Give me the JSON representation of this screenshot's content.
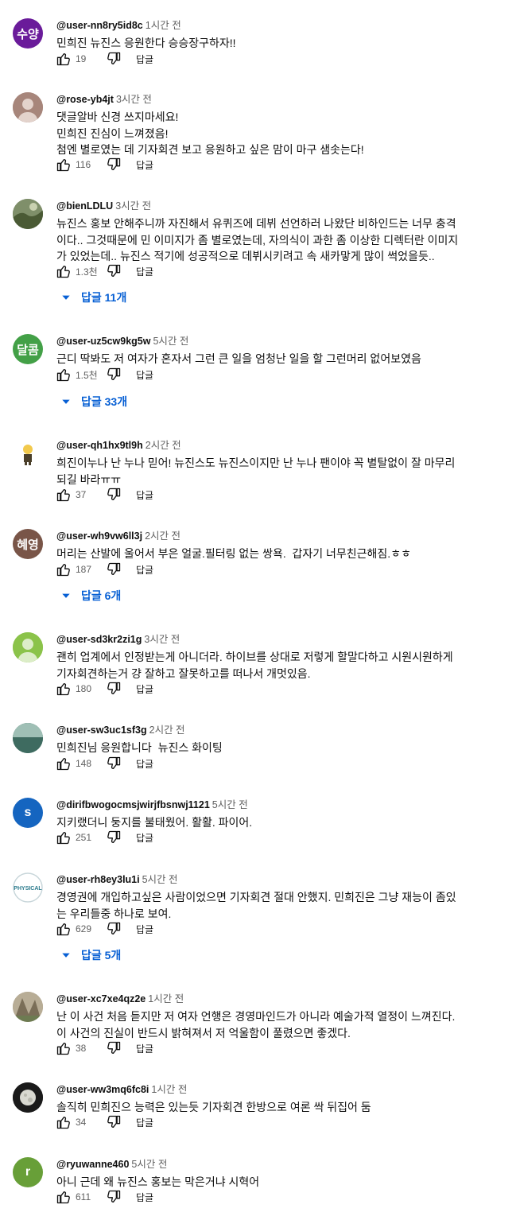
{
  "icons": {
    "like": "thumb-up-icon",
    "dislike": "thumb-down-icon",
    "expand": "caret-down-icon"
  },
  "reply_label": "답글",
  "comments": [
    {
      "handle": "@user-nn8ry5id8c",
      "time": "1시간 전",
      "avatar_text": "수양",
      "avatar_color": "#6a1b9a",
      "text": "민희진 뉴진스 응원한다 승승장구하자!!",
      "likes": "19",
      "replies": ""
    },
    {
      "handle": "@rose-yb4jt",
      "time": "3시간 전",
      "avatar_text": "",
      "avatar_color": "#a7867b",
      "text": "댓글알바 신경 쓰지마세요!\n민희진 진심이 느껴졌음!\n첨엔 별로였는 데 기자회견 보고 응원하고 싶은 맘이 마구 샘솟는다!",
      "likes": "116",
      "replies": ""
    },
    {
      "handle": "@bienLDLU",
      "time": "3시간 전",
      "avatar_text": "",
      "avatar_color": "#5d6b48",
      "text": "뉴진스 홍보 안해주니까 자진해서 유퀴즈에 데뷔 선언하러 나왔단 비하인드는 너무 충격\n이다.. 그것때문에 민 이미지가 좀 별로였는데, 자의식이 과한 좀 이상한 디렉터란 이미지\n가 있었는데.. 뉴진스 적기에 성공적으로 데뷔시키려고 속 새카맣게 많이 썩었을듯..",
      "likes": "1.3천",
      "replies": "답글 11개"
    },
    {
      "handle": "@user-uz5cw9kg5w",
      "time": "5시간 전",
      "avatar_text": "달콤",
      "avatar_color": "#43a047",
      "text": "근디 딱봐도 저 여자가 혼자서 그런 큰 일을 엄청난 일을 할 그런머리 없어보였음",
      "likes": "1.5천",
      "replies": "답글 33개"
    },
    {
      "handle": "@user-qh1hx9tl9h",
      "time": "2시간 전",
      "avatar_text": "",
      "avatar_color": "#ffffff",
      "text": "희진이누나 난 누나 믿어! 뉴진스도 뉴진스이지만 난 누나 팬이야 꼭 별탈없이 잘 마무리\n되길 바라ㅠㅠ",
      "likes": "37",
      "replies": ""
    },
    {
      "handle": "@user-wh9vw6ll3j",
      "time": "2시간 전",
      "avatar_text": "혜영",
      "avatar_color": "#795548",
      "text": "머리는 산발에 울어서 부은 얼굴.필터링 없는 쌍욕.  갑자기 너무친근해짐.ㅎㅎ",
      "likes": "187",
      "replies": "답글 6개"
    },
    {
      "handle": "@user-sd3kr2zi1g",
      "time": "3시간 전",
      "avatar_text": "",
      "avatar_color": "#8bc34a",
      "text": "괜히 업계에서 인정받는게 아니더라. 하이브를 상대로 저렇게 할말다하고 시원시원하게\n기자회견하는거 걍 잘하고 잘못하고를 떠나서 개멋있음.",
      "likes": "180",
      "replies": ""
    },
    {
      "handle": "@user-sw3uc1sf3g",
      "time": "2시간 전",
      "avatar_text": "",
      "avatar_color": "#4e7d6e",
      "text": "민희진님 응원합니다  뉴진스 화이팅",
      "likes": "148",
      "replies": ""
    },
    {
      "handle": "@dirifbwogocmsjwirjfbsnwj1121",
      "time": "5시간 전",
      "avatar_text": "s",
      "avatar_color": "#1565c0",
      "text": "지키랬더니 둥지를 불태웠어. 활활. 파이어.",
      "likes": "251",
      "replies": ""
    },
    {
      "handle": "@user-rh8ey3lu1i",
      "time": "5시간 전",
      "avatar_text": "PHYSICAL",
      "avatar_color": "#ffffff",
      "text": "경영권에 개입하고싶은 사람이었으면 기자회견 절대 안했지. 민희진은 그냥 재능이 좀있\n는 우리들중 하나로 보여.",
      "likes": "629",
      "replies": "답글 5개"
    },
    {
      "handle": "@user-xc7xe4qz2e",
      "time": "1시간 전",
      "avatar_text": "",
      "avatar_color": "#9c8f7a",
      "text": "난 이 사건 처음 듣지만 저 여자 언행은 경영마인드가 아니라 예술가적 열정이 느껴진다.\n이 사건의 진실이 반드시 밝혀져서 저 억울함이 풀렸으면 좋겠다.",
      "likes": "38",
      "replies": ""
    },
    {
      "handle": "@user-ww3mq6fc8i",
      "time": "1시간 전",
      "avatar_text": "",
      "avatar_color": "#1a1a1a",
      "text": "솔직히 민희진으 능력은 있는듯 기자회견 한방으로 여론 싹 뒤집어 둠",
      "likes": "34",
      "replies": ""
    },
    {
      "handle": "@ryuwanne460",
      "time": "5시간 전",
      "avatar_text": "r",
      "avatar_color": "#689f38",
      "text": "아니 근데 왜 뉴진스 홍보는 막은거냐 시혁어",
      "likes": "611",
      "replies": ""
    }
  ]
}
